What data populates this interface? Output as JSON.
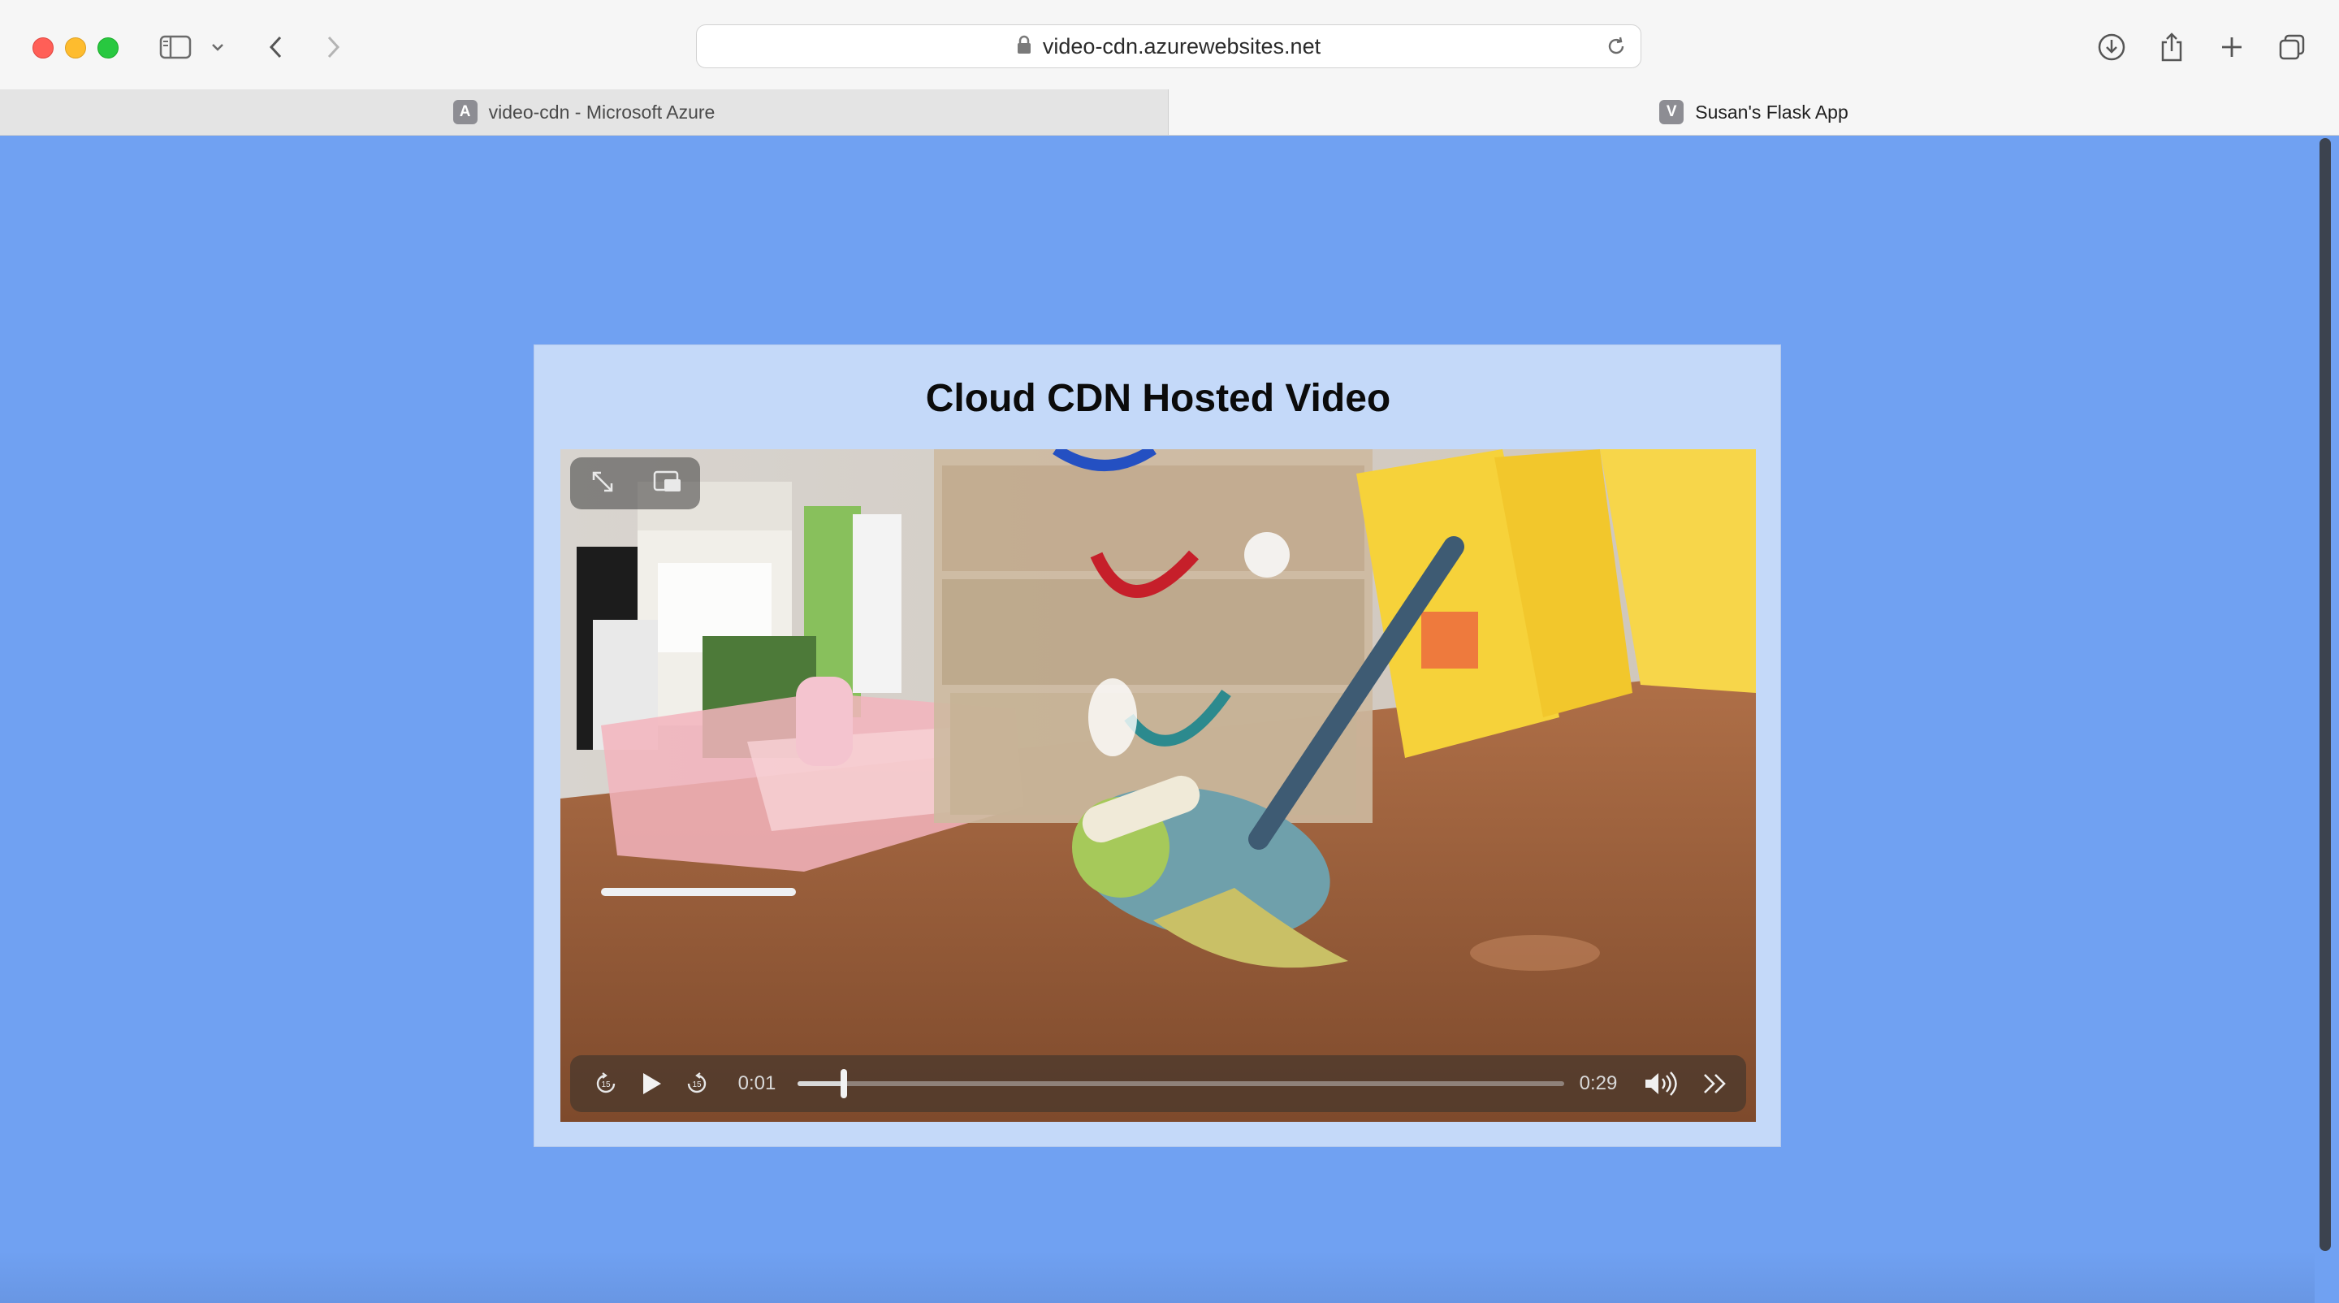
{
  "browser": {
    "url": "video-cdn.azurewebsites.net",
    "tabs": [
      {
        "favicon": "A",
        "label": "video-cdn - Microsoft Azure"
      },
      {
        "favicon": "V",
        "label": "Susan's Flask App"
      }
    ]
  },
  "page": {
    "title": "Cloud CDN Hosted Video",
    "background_color": "#70a1f2",
    "card_color": "#c4d9f9"
  },
  "player": {
    "current_time": "0:01",
    "duration": "0:29",
    "progress_fraction": 0.06,
    "icons": [
      "fullscreen-icon",
      "picture-in-picture-icon",
      "skip-back-15-icon",
      "play-icon",
      "skip-forward-15-icon",
      "volume-icon",
      "more-controls-icon"
    ]
  }
}
